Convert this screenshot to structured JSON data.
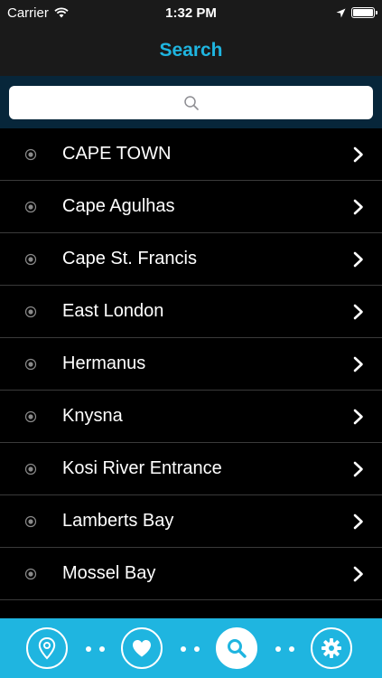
{
  "status_bar": {
    "carrier": "Carrier",
    "time": "1:32 PM"
  },
  "nav": {
    "title": "Search"
  },
  "search": {
    "placeholder": "",
    "value": ""
  },
  "locations": [
    {
      "label": "CAPE TOWN"
    },
    {
      "label": "Cape Agulhas"
    },
    {
      "label": "Cape St. Francis"
    },
    {
      "label": "East London"
    },
    {
      "label": "Hermanus"
    },
    {
      "label": "Knysna"
    },
    {
      "label": "Kosi River Entrance"
    },
    {
      "label": "Lamberts Bay"
    },
    {
      "label": "Mossel Bay"
    },
    {
      "label": ""
    }
  ],
  "tabs": [
    {
      "icon": "location-pin-icon"
    },
    {
      "icon": "heart-icon"
    },
    {
      "icon": "search-icon",
      "active": true
    },
    {
      "icon": "gear-icon"
    }
  ],
  "colors": {
    "accent": "#1fb5e0",
    "search_bg": "#07263a",
    "bar_bg": "#1a1a1a"
  }
}
